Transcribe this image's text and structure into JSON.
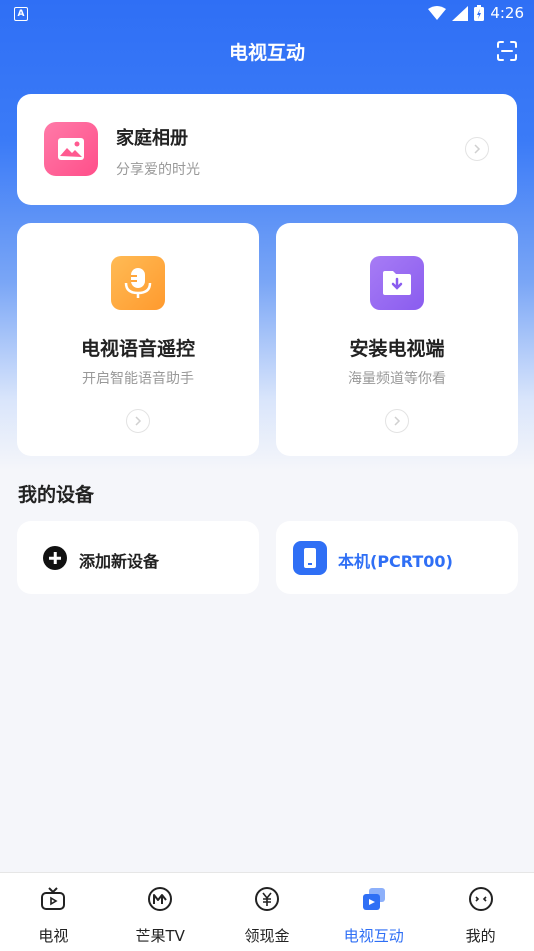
{
  "status_bar": {
    "time": "4:26",
    "notification_glyph": "A"
  },
  "header": {
    "title": "电视互动",
    "scan_icon": "scan-icon"
  },
  "album_card": {
    "title": "家庭相册",
    "subtitle": "分享爱的时光",
    "icon": "photo-album-icon",
    "icon_color": "#ff5a90"
  },
  "feature_cards": [
    {
      "title": "电视语音遥控",
      "subtitle": "开启智能语音助手",
      "icon": "microphone-icon",
      "icon_color": "#ffa53a"
    },
    {
      "title": "安装电视端",
      "subtitle": "海量频道等你看",
      "icon": "folder-download-icon",
      "icon_color": "#9a6af2"
    }
  ],
  "devices": {
    "section_title": "我的设备",
    "add_label": "添加新设备",
    "local_label": "本机(PCRT00)"
  },
  "tabs": [
    {
      "label": "电视",
      "icon": "tv-icon",
      "active": false
    },
    {
      "label": "芒果TV",
      "icon": "mango-tv-icon",
      "active": false
    },
    {
      "label": "领现金",
      "icon": "yen-coin-icon",
      "active": false
    },
    {
      "label": "电视互动",
      "icon": "tv-interact-icon",
      "active": true
    },
    {
      "label": "我的",
      "icon": "profile-face-icon",
      "active": false
    }
  ],
  "colors": {
    "accent": "#2f6ff5",
    "background": "#f5f6fa"
  }
}
